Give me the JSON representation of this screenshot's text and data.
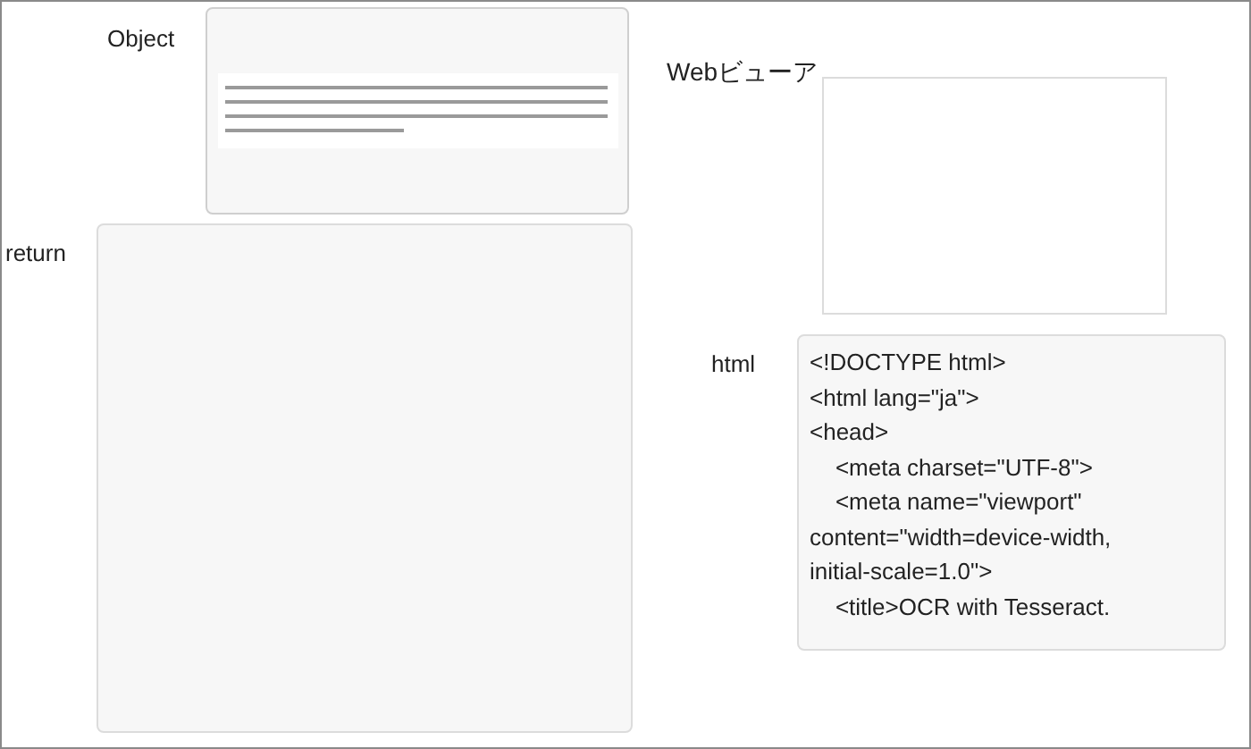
{
  "object": {
    "label": "Object"
  },
  "return": {
    "label": "return"
  },
  "webview": {
    "label": "Webビューア"
  },
  "html": {
    "label": "html",
    "lines": [
      "<!DOCTYPE html>",
      "<html lang=\"ja\">",
      "<head>",
      "    <meta charset=\"UTF-8\">",
      "    <meta name=\"viewport\"",
      "content=\"width=device-width,",
      "initial-scale=1.0\">",
      "    <title>OCR with Tesseract."
    ]
  }
}
